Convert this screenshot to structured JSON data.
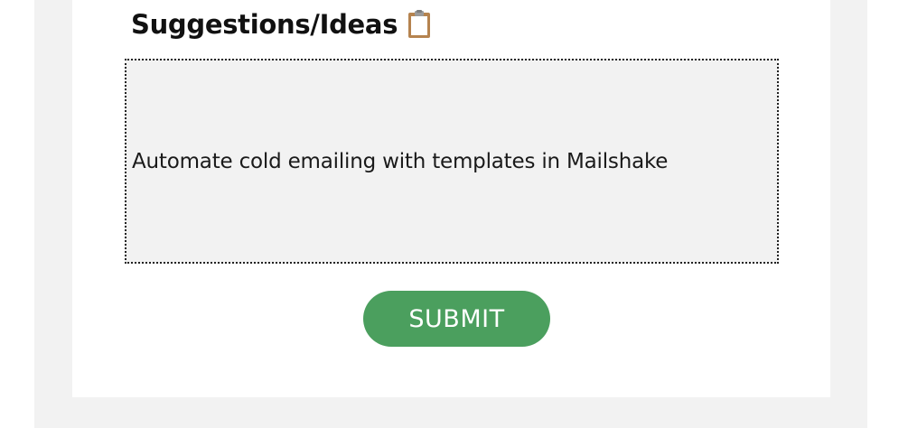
{
  "form": {
    "field_label": "Suggestions/Ideas",
    "field_icon": "clipboard-icon",
    "textarea_value": "Automate cold emailing with templates in Mailshake",
    "submit_label": "SUBMIT"
  },
  "colors": {
    "page_background": "#ffffff",
    "panel_background": "#f2f2f2",
    "textarea_background": "#f2f2f2",
    "textarea_border": "#222222",
    "submit_button": "#4b9f5e",
    "submit_text": "#ffffff"
  }
}
